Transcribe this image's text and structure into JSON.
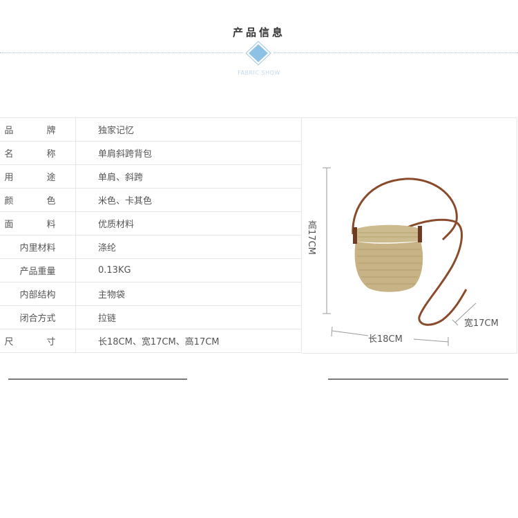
{
  "header": {
    "title": "产品信息",
    "subtitle": "FABRIC SHOW"
  },
  "colors": {
    "accent": "#8ec1e6",
    "rule": "#9cc6e2",
    "strap": "#8a4a2c",
    "straw": "#c9b68b"
  },
  "specs": [
    {
      "key": "品  牌",
      "value": "独家记忆"
    },
    {
      "key": "名  称",
      "value": "单肩斜跨背包"
    },
    {
      "key": "用  途",
      "value": "单肩、斜跨"
    },
    {
      "key": "颜  色",
      "value": "米色、卡其色"
    },
    {
      "key": "面  料",
      "value": "优质材料"
    },
    {
      "key": "内里材料",
      "value": "涤纶"
    },
    {
      "key": "产品重量",
      "value": "0.13KG"
    },
    {
      "key": "内部结构",
      "value": "主物袋"
    },
    {
      "key": "闭合方式",
      "value": "拉链"
    },
    {
      "key": "尺  寸",
      "value": "长18CM、宽17CM、高17CM"
    }
  ],
  "dimensions": {
    "height": "高17CM",
    "length": "长18CM",
    "width": "宽17CM"
  }
}
